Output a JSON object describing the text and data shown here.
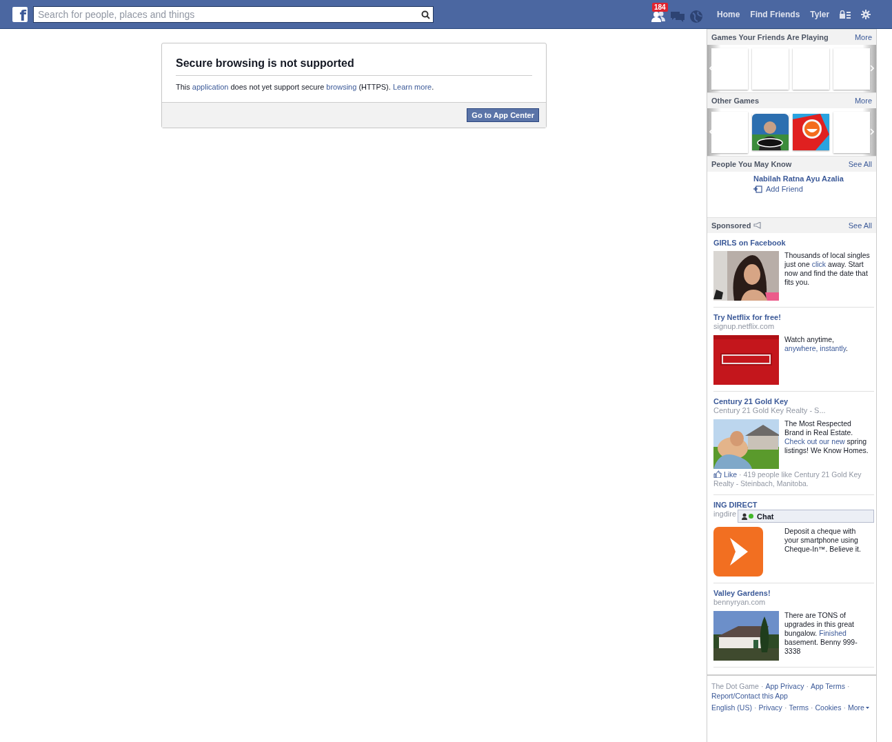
{
  "topbar": {
    "logo": "f",
    "search": {
      "placeholder": "Search for people, places and things"
    },
    "jewels": [
      {
        "kind": "friends",
        "badge": "184"
      },
      {
        "kind": "messages"
      },
      {
        "kind": "globe"
      }
    ],
    "nav": [
      "Home",
      "Find Friends",
      "Tyler"
    ]
  },
  "dialog": {
    "title": "Secure browsing is not supported",
    "message": [
      {
        "kind": "text",
        "text": "This "
      },
      {
        "kind": "link",
        "text": "application"
      },
      {
        "kind": "text",
        "text": " does not yet support secure "
      },
      {
        "kind": "link",
        "text": "browsing"
      },
      {
        "kind": "text",
        "text": " (HTTPS). "
      },
      {
        "kind": "link",
        "text": "Learn more"
      },
      {
        "kind": "text",
        "text": "."
      }
    ],
    "button": "Go to App Center"
  },
  "games_friends": {
    "title": "Games Your Friends Are Playing",
    "more": "More",
    "tiles": [
      {
        "kind": "empty"
      },
      {
        "kind": "empty"
      },
      {
        "kind": "empty"
      },
      {
        "kind": "empty"
      }
    ]
  },
  "other_games": {
    "title": "Other Games",
    "more": "More",
    "tiles": [
      {
        "kind": "empty"
      },
      {
        "kind": "picture"
      },
      {
        "kind": "picture"
      },
      {
        "kind": "empty"
      }
    ]
  },
  "people": {
    "title": "People You May Know",
    "see_all": "See All",
    "name": "Nabilah Ratna Ayu Azalia",
    "action": "Add Friend"
  },
  "sponsored": {
    "title": "Sponsored",
    "see_all": "See All",
    "ads": [
      {
        "title": "GIRLS on Facebook",
        "body": [
          {
            "kind": "text",
            "text": "Thousands of local singles just one "
          },
          {
            "kind": "link",
            "text": "click"
          },
          {
            "kind": "text",
            "text": " away. Start now and find the date that fits you."
          }
        ]
      },
      {
        "title": "Try Netflix for free!",
        "url": "signup.netflix.com",
        "body": [
          {
            "kind": "text",
            "text": "Watch anytime, "
          },
          {
            "kind": "link",
            "text": "anywhere, instantly"
          },
          {
            "kind": "text",
            "text": "."
          }
        ]
      },
      {
        "title": "Century 21 Gold Key",
        "url": "Century 21 Gold Key Realty - S...",
        "body": [
          {
            "kind": "text",
            "text": "The Most Respected Brand in Real Estate. "
          },
          {
            "kind": "link",
            "text": "Check out our new"
          },
          {
            "kind": "text",
            "text": " spring listings! We Know Homes."
          }
        ],
        "social": {
          "like": "Like",
          "text": " · 419 people like Century 21 Gold Key Realty - Steinbach, Manitoba."
        }
      },
      {
        "title": "ING DIRECT",
        "url": "ingdire",
        "body": [
          {
            "kind": "text",
            "text": "Deposit a cheque with your smartphone using Cheque-In™. Believe it."
          }
        ]
      },
      {
        "title": "Valley Gardens!",
        "url": "bennyryan.com",
        "body": [
          {
            "kind": "text",
            "text": "There are TONS of upgrades in this great bungalow. "
          },
          {
            "kind": "link",
            "text": "Finished"
          },
          {
            "kind": "text",
            "text": " basement. Benny 999-3338"
          }
        ]
      }
    ]
  },
  "chat": {
    "label": "Chat",
    "online": true
  },
  "footer": {
    "lines": [
      [
        {
          "kind": "muted",
          "text": "The Dot Game"
        },
        {
          "kind": "sep",
          "text": "·"
        },
        {
          "kind": "link",
          "text": "App Privacy"
        },
        {
          "kind": "sep",
          "text": "·"
        },
        {
          "kind": "link",
          "text": "App Terms"
        },
        {
          "kind": "sep",
          "text": "·"
        },
        {
          "kind": "link",
          "text": "Report/Contact this App"
        }
      ],
      [
        {
          "kind": "link",
          "text": "English (US)"
        },
        {
          "kind": "sep",
          "text": "·"
        },
        {
          "kind": "link",
          "text": "Privacy"
        },
        {
          "kind": "sep",
          "text": "·"
        },
        {
          "kind": "link",
          "text": "Terms"
        },
        {
          "kind": "sep",
          "text": "·"
        },
        {
          "kind": "link",
          "text": "Cookies"
        },
        {
          "kind": "sep",
          "text": "·"
        },
        {
          "kind": "link",
          "text": "More"
        }
      ]
    ]
  }
}
